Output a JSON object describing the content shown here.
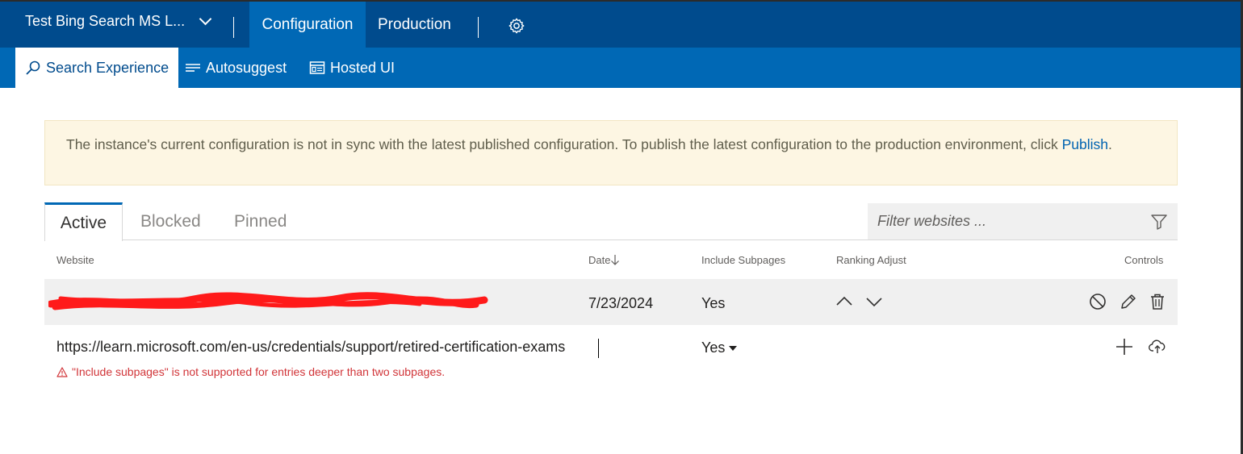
{
  "header": {
    "instance_name": "Test Bing Search MS L...",
    "tabs": [
      {
        "label": "Configuration",
        "active": true
      },
      {
        "label": "Production",
        "active": false
      }
    ],
    "settings_icon": "gear-icon"
  },
  "subnav": {
    "items": [
      {
        "label": "Search Experience",
        "icon": "search-icon",
        "active": true
      },
      {
        "label": "Autosuggest",
        "icon": "lines-icon",
        "active": false
      },
      {
        "label": "Hosted UI",
        "icon": "window-icon",
        "active": false
      }
    ]
  },
  "banner": {
    "message": "The instance's current configuration is not in sync with the latest published configuration. To publish the latest configuration to the production environment, click",
    "link": "Publish",
    "suffix": "."
  },
  "content_tabs": [
    {
      "label": "Active",
      "active": true
    },
    {
      "label": "Blocked",
      "active": false
    },
    {
      "label": "Pinned",
      "active": false
    }
  ],
  "filter": {
    "placeholder": "Filter websites ..."
  },
  "table": {
    "columns": {
      "website": "Website",
      "date": "Date",
      "include_subpages": "Include Subpages",
      "ranking_adjust": "Ranking Adjust",
      "controls": "Controls"
    },
    "rows": [
      {
        "website": "",
        "date": "7/23/2024",
        "include_subpages": "Yes"
      }
    ]
  },
  "new_entry": {
    "url": "https://learn.microsoft.com/en-us/credentials/support/retired-certification-exams",
    "include_subpages": "Yes",
    "error": "\"Include subpages\" is not supported for entries deeper than two subpages."
  },
  "colors": {
    "top_bar": "#004b8d",
    "sub_bar": "#0068b5",
    "banner_bg": "#fdf6e3",
    "error": "#d13438"
  }
}
